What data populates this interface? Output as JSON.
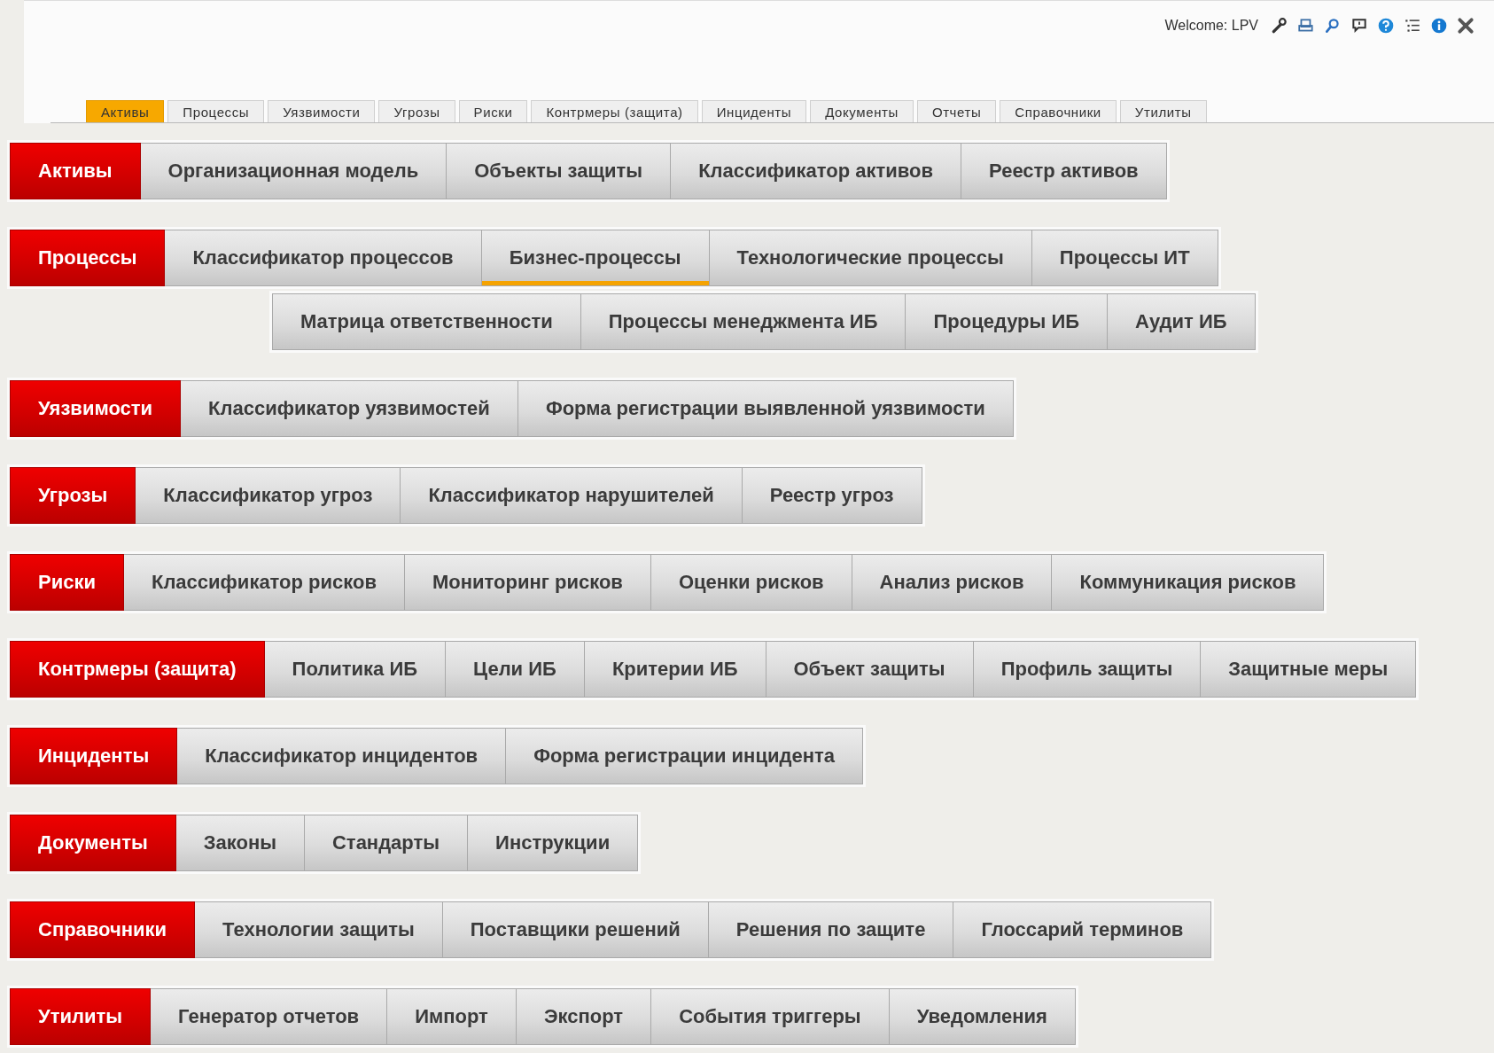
{
  "header": {
    "welcome": "Welcome: LPV"
  },
  "tabs": [
    {
      "label": "Активы",
      "selected": true
    },
    {
      "label": "Процессы",
      "selected": false
    },
    {
      "label": "Уязвимости",
      "selected": false
    },
    {
      "label": "Угрозы",
      "selected": false
    },
    {
      "label": "Риски",
      "selected": false
    },
    {
      "label": "Контрмеры (защита)",
      "selected": false
    },
    {
      "label": "Инциденты",
      "selected": false
    },
    {
      "label": "Документы",
      "selected": false
    },
    {
      "label": "Отчеты",
      "selected": false
    },
    {
      "label": "Справочники",
      "selected": false
    },
    {
      "label": "Утилиты",
      "selected": false
    }
  ],
  "menus": [
    {
      "head": "Активы",
      "rows": [
        [
          {
            "label": "Организационная модель",
            "selected": false
          },
          {
            "label": "Объекты защиты",
            "selected": false
          },
          {
            "label": "Классификатор активов",
            "selected": false
          },
          {
            "label": "Реестр активов",
            "selected": false
          }
        ]
      ]
    },
    {
      "head": "Процессы",
      "rows": [
        [
          {
            "label": "Классификатор процессов",
            "selected": false
          },
          {
            "label": "Бизнес-процессы",
            "selected": true
          },
          {
            "label": "Технологические процессы",
            "selected": false
          },
          {
            "label": "Процессы ИТ",
            "selected": false
          }
        ],
        [
          {
            "label": "Матрица ответственности",
            "selected": false
          },
          {
            "label": "Процессы менеджмента ИБ",
            "selected": false
          },
          {
            "label": "Процедуры ИБ",
            "selected": false
          },
          {
            "label": "Аудит ИБ",
            "selected": false
          }
        ]
      ]
    },
    {
      "head": "Уязвимости",
      "rows": [
        [
          {
            "label": "Классификатор уязвимостей",
            "selected": false
          },
          {
            "label": "Форма регистрации выявленной уязвимости",
            "selected": false
          }
        ]
      ]
    },
    {
      "head": "Угрозы",
      "rows": [
        [
          {
            "label": "Классификатор угроз",
            "selected": false
          },
          {
            "label": "Классификатор нарушителей",
            "selected": false
          },
          {
            "label": "Реестр угроз",
            "selected": false
          }
        ]
      ]
    },
    {
      "head": "Риски",
      "rows": [
        [
          {
            "label": "Классификатор рисков",
            "selected": false
          },
          {
            "label": "Мониторинг рисков",
            "selected": false
          },
          {
            "label": "Оценки рисков",
            "selected": false
          },
          {
            "label": "Анализ рисков",
            "selected": false
          },
          {
            "label": "Коммуникация рисков",
            "selected": false
          }
        ]
      ]
    },
    {
      "head": "Контрмеры (защита)",
      "rows": [
        [
          {
            "label": "Политика ИБ",
            "selected": false
          },
          {
            "label": "Цели ИБ",
            "selected": false
          },
          {
            "label": "Критерии ИБ",
            "selected": false
          },
          {
            "label": "Объект защиты",
            "selected": false
          },
          {
            "label": "Профиль защиты",
            "selected": false
          },
          {
            "label": "Защитные меры",
            "selected": false
          }
        ]
      ]
    },
    {
      "head": "Инциденты",
      "rows": [
        [
          {
            "label": "Классификатор инцидентов",
            "selected": false
          },
          {
            "label": "Форма регистрации инцидента",
            "selected": false
          }
        ]
      ]
    },
    {
      "head": "Документы",
      "rows": [
        [
          {
            "label": "Законы",
            "selected": false
          },
          {
            "label": "Стандарты",
            "selected": false
          },
          {
            "label": "Инструкции",
            "selected": false
          }
        ]
      ]
    },
    {
      "head": "Справочники",
      "rows": [
        [
          {
            "label": "Технологии защиты",
            "selected": false
          },
          {
            "label": "Поставщики решений",
            "selected": false
          },
          {
            "label": "Решения по защите",
            "selected": false
          },
          {
            "label": "Глоссарий терминов",
            "selected": false
          }
        ]
      ]
    },
    {
      "head": "Утилиты",
      "rows": [
        [
          {
            "label": "Генератор отчетов",
            "selected": false
          },
          {
            "label": "Импорт",
            "selected": false
          },
          {
            "label": "Экспорт",
            "selected": false
          },
          {
            "label": "События триггеры",
            "selected": false
          },
          {
            "label": "Уведомления",
            "selected": false
          }
        ]
      ]
    }
  ]
}
